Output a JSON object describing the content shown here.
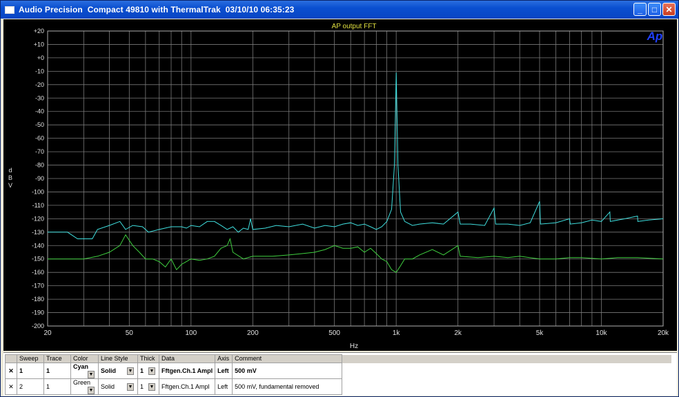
{
  "window": {
    "title": "Audio Precision  Compact 49810 with ThermalTrak  03/10/10 06:35:23",
    "buttons": {
      "minimize": "_",
      "maximize": "□",
      "close": "✕"
    }
  },
  "chart_data": {
    "type": "line",
    "title": "AP output FFT",
    "logo": "Ap",
    "xlabel": "Hz",
    "ylabel": "dBV",
    "xscale": "log",
    "xlim": [
      20,
      20000
    ],
    "ylim": [
      -200,
      20
    ],
    "x_ticks": [
      20,
      50,
      100,
      200,
      500,
      1000,
      2000,
      5000,
      10000,
      20000
    ],
    "x_tick_labels": [
      "20",
      "50",
      "100",
      "200",
      "500",
      "1k",
      "2k",
      "5k",
      "10k",
      "20k"
    ],
    "y_ticks": [
      20,
      10,
      0,
      -10,
      -20,
      -30,
      -40,
      -50,
      -60,
      -70,
      -80,
      -90,
      -100,
      -110,
      -120,
      -130,
      -140,
      -150,
      -160,
      -170,
      -180,
      -190,
      -200
    ],
    "y_tick_labels": [
      "+20",
      "+10",
      "+0",
      "-10",
      "-20",
      "-30",
      "-40",
      "-50",
      "-60",
      "-70",
      "-80",
      "-90",
      "-100",
      "-110",
      "-120",
      "-130",
      "-140",
      "-150",
      "-160",
      "-170",
      "-180",
      "-190",
      "-200"
    ],
    "grid": true,
    "background": "#000000",
    "series": [
      {
        "name": "500 mV",
        "color": "#40e0e0",
        "points": [
          [
            20,
            -130
          ],
          [
            25,
            -130
          ],
          [
            28,
            -135
          ],
          [
            33,
            -135
          ],
          [
            35,
            -128
          ],
          [
            40,
            -125
          ],
          [
            45,
            -122
          ],
          [
            48,
            -128
          ],
          [
            52,
            -125
          ],
          [
            58,
            -126
          ],
          [
            62,
            -130
          ],
          [
            70,
            -128
          ],
          [
            80,
            -126
          ],
          [
            90,
            -126
          ],
          [
            95,
            -127
          ],
          [
            100,
            -125
          ],
          [
            110,
            -126
          ],
          [
            120,
            -122
          ],
          [
            130,
            -122
          ],
          [
            140,
            -125
          ],
          [
            150,
            -128
          ],
          [
            160,
            -126
          ],
          [
            170,
            -130
          ],
          [
            180,
            -127
          ],
          [
            190,
            -128
          ],
          [
            195,
            -120
          ],
          [
            200,
            -128
          ],
          [
            230,
            -127
          ],
          [
            260,
            -125
          ],
          [
            300,
            -126
          ],
          [
            350,
            -124
          ],
          [
            400,
            -127
          ],
          [
            450,
            -125
          ],
          [
            500,
            -126
          ],
          [
            550,
            -124
          ],
          [
            600,
            -123
          ],
          [
            650,
            -125
          ],
          [
            700,
            -124
          ],
          [
            750,
            -126
          ],
          [
            800,
            -128
          ],
          [
            850,
            -126
          ],
          [
            900,
            -122
          ],
          [
            950,
            -113
          ],
          [
            980,
            -80
          ],
          [
            1000,
            -11
          ],
          [
            1020,
            -80
          ],
          [
            1050,
            -115
          ],
          [
            1100,
            -122
          ],
          [
            1200,
            -125
          ],
          [
            1300,
            -124
          ],
          [
            1500,
            -123
          ],
          [
            1700,
            -124
          ],
          [
            2000,
            -115
          ],
          [
            2050,
            -124
          ],
          [
            2300,
            -124
          ],
          [
            2700,
            -125
          ],
          [
            3000,
            -112
          ],
          [
            3050,
            -124
          ],
          [
            3500,
            -124
          ],
          [
            4000,
            -125
          ],
          [
            4500,
            -123
          ],
          [
            5000,
            -107
          ],
          [
            5050,
            -124
          ],
          [
            6000,
            -123
          ],
          [
            7000,
            -120
          ],
          [
            7050,
            -124
          ],
          [
            8000,
            -123
          ],
          [
            9000,
            -121
          ],
          [
            10000,
            -122
          ],
          [
            11000,
            -115
          ],
          [
            11050,
            -122
          ],
          [
            13000,
            -120
          ],
          [
            15000,
            -118
          ],
          [
            15050,
            -122
          ],
          [
            17000,
            -121
          ],
          [
            20000,
            -120
          ]
        ]
      },
      {
        "name": "500 mV, fundamental removed",
        "color": "#40d040",
        "points": [
          [
            20,
            -150
          ],
          [
            25,
            -150
          ],
          [
            30,
            -150
          ],
          [
            35,
            -148
          ],
          [
            40,
            -145
          ],
          [
            45,
            -140
          ],
          [
            48,
            -132
          ],
          [
            52,
            -140
          ],
          [
            56,
            -145
          ],
          [
            60,
            -150
          ],
          [
            65,
            -150
          ],
          [
            70,
            -152
          ],
          [
            75,
            -156
          ],
          [
            80,
            -150
          ],
          [
            85,
            -158
          ],
          [
            90,
            -154
          ],
          [
            100,
            -150
          ],
          [
            110,
            -151
          ],
          [
            120,
            -150
          ],
          [
            130,
            -148
          ],
          [
            140,
            -142
          ],
          [
            150,
            -140
          ],
          [
            155,
            -135
          ],
          [
            160,
            -145
          ],
          [
            180,
            -150
          ],
          [
            200,
            -148
          ],
          [
            220,
            -148
          ],
          [
            250,
            -148
          ],
          [
            300,
            -147
          ],
          [
            350,
            -146
          ],
          [
            400,
            -145
          ],
          [
            450,
            -143
          ],
          [
            500,
            -140
          ],
          [
            550,
            -142
          ],
          [
            600,
            -142
          ],
          [
            650,
            -141
          ],
          [
            700,
            -145
          ],
          [
            750,
            -142
          ],
          [
            800,
            -146
          ],
          [
            850,
            -150
          ],
          [
            900,
            -152
          ],
          [
            950,
            -158
          ],
          [
            1000,
            -160
          ],
          [
            1050,
            -155
          ],
          [
            1100,
            -150
          ],
          [
            1200,
            -150
          ],
          [
            1300,
            -147
          ],
          [
            1500,
            -143
          ],
          [
            1700,
            -147
          ],
          [
            2000,
            -140
          ],
          [
            2050,
            -148
          ],
          [
            2500,
            -149
          ],
          [
            3000,
            -148
          ],
          [
            3500,
            -149
          ],
          [
            4000,
            -148
          ],
          [
            5000,
            -150
          ],
          [
            6000,
            -150
          ],
          [
            7000,
            -149
          ],
          [
            8000,
            -149
          ],
          [
            10000,
            -150
          ],
          [
            12000,
            -149
          ],
          [
            15000,
            -149
          ],
          [
            20000,
            -150
          ]
        ]
      }
    ]
  },
  "legend": {
    "headers": [
      "Sweep",
      "Trace",
      "Color",
      "Line Style",
      "Thick",
      "Data",
      "Axis",
      "Comment"
    ],
    "rows": [
      {
        "checked": "✕",
        "sweep": "1",
        "trace": "1",
        "color": "Cyan",
        "style": "Solid",
        "thick": "1",
        "data": "Fftgen.Ch.1 Ampl",
        "axis": "Left",
        "comment": "500 mV"
      },
      {
        "checked": "✕",
        "sweep": "2",
        "trace": "1",
        "color": "Green",
        "style": "Solid",
        "thick": "1",
        "data": "Fftgen.Ch.1 Ampl",
        "axis": "Left",
        "comment": "500 mV, fundamental removed"
      }
    ]
  }
}
